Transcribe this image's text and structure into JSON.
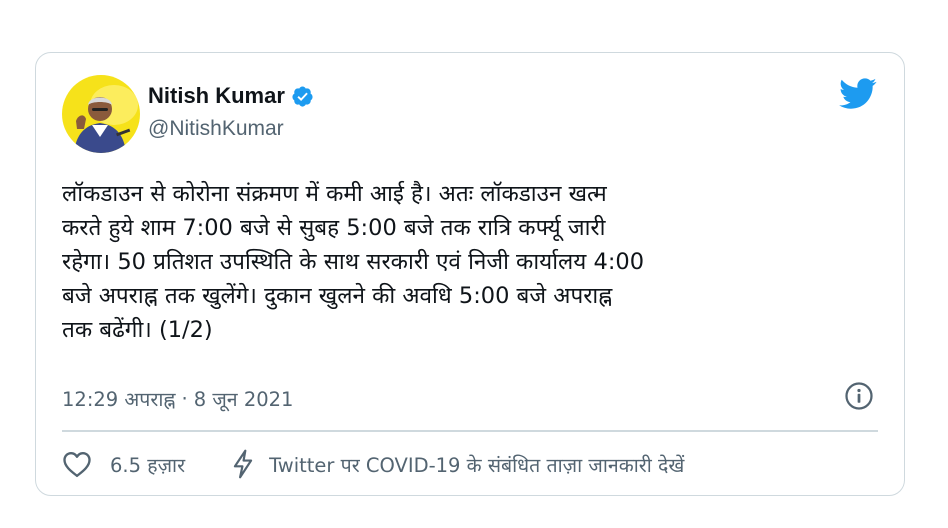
{
  "author": {
    "name": "Nitish Kumar",
    "handle": "@NitishKumar",
    "verified": true
  },
  "tweet": {
    "lines": [
      "लॉकडाउन से कोरोना संक्रमण में कमी आई है। अतः लॉकडाउन खत्म",
      "करते हुये शाम 7:00 बजे से सुबह 5:00 बजे तक रात्रि कर्फ्यू जारी",
      "रहेगा। 50 प्रतिशत उपस्थिति के साथ सरकारी एवं निजी कार्यालय 4:00",
      "बजे अपराह्न तक खुलेंगे। दुकान खुलने की अवधि 5:00 बजे अपराह्न",
      "तक बढेंगी। (1/2)"
    ],
    "time": "12:29 अपराह्न",
    "separator": "·",
    "date": "8 जून 2021"
  },
  "actions": {
    "like_count": "6.5 हज़ार",
    "covid_link": "Twitter पर COVID-19 के संबंधित ताज़ा जानकारी देखें"
  },
  "colors": {
    "twitter_blue": "#1d9bf0",
    "text": "#0f1419",
    "secondary": "#536471",
    "border": "#cfd9de",
    "avatar_bg": "#f6e21a"
  },
  "icons": [
    "twitter-bird-icon",
    "verified-badge-icon",
    "info-icon",
    "heart-icon",
    "lightning-bolt-icon"
  ]
}
